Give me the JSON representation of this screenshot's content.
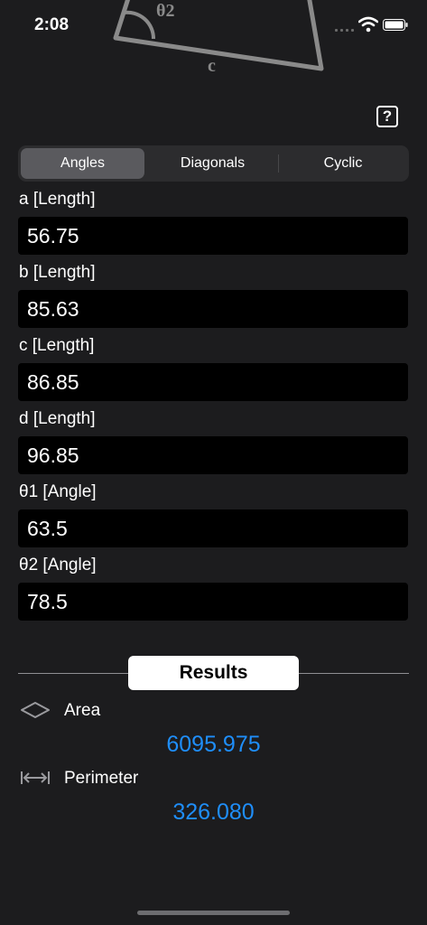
{
  "status_bar": {
    "time": "2:08"
  },
  "diagram": {
    "angle_label": "θ2",
    "side_label": "c"
  },
  "help": {
    "label": "?"
  },
  "tabs": [
    {
      "label": "Angles",
      "active": true
    },
    {
      "label": "Diagonals",
      "active": false
    },
    {
      "label": "Cyclic",
      "active": false
    }
  ],
  "fields": [
    {
      "label": "a [Length]",
      "value": "56.75"
    },
    {
      "label": "b [Length]",
      "value": "85.63"
    },
    {
      "label": "c [Length]",
      "value": "86.85"
    },
    {
      "label": "d [Length]",
      "value": "96.85"
    },
    {
      "label": "θ1 [Angle]",
      "value": "63.5"
    },
    {
      "label": "θ2 [Angle]",
      "value": "78.5"
    }
  ],
  "results": {
    "title": "Results",
    "area": {
      "label": "Area",
      "value": "6095.975",
      "icon": "diamond-icon"
    },
    "perimeter": {
      "label": "Perimeter",
      "value": "326.080",
      "icon": "width-arrows-icon"
    }
  },
  "colors": {
    "accent": "#1f8efa",
    "background": "#1c1c1e"
  }
}
